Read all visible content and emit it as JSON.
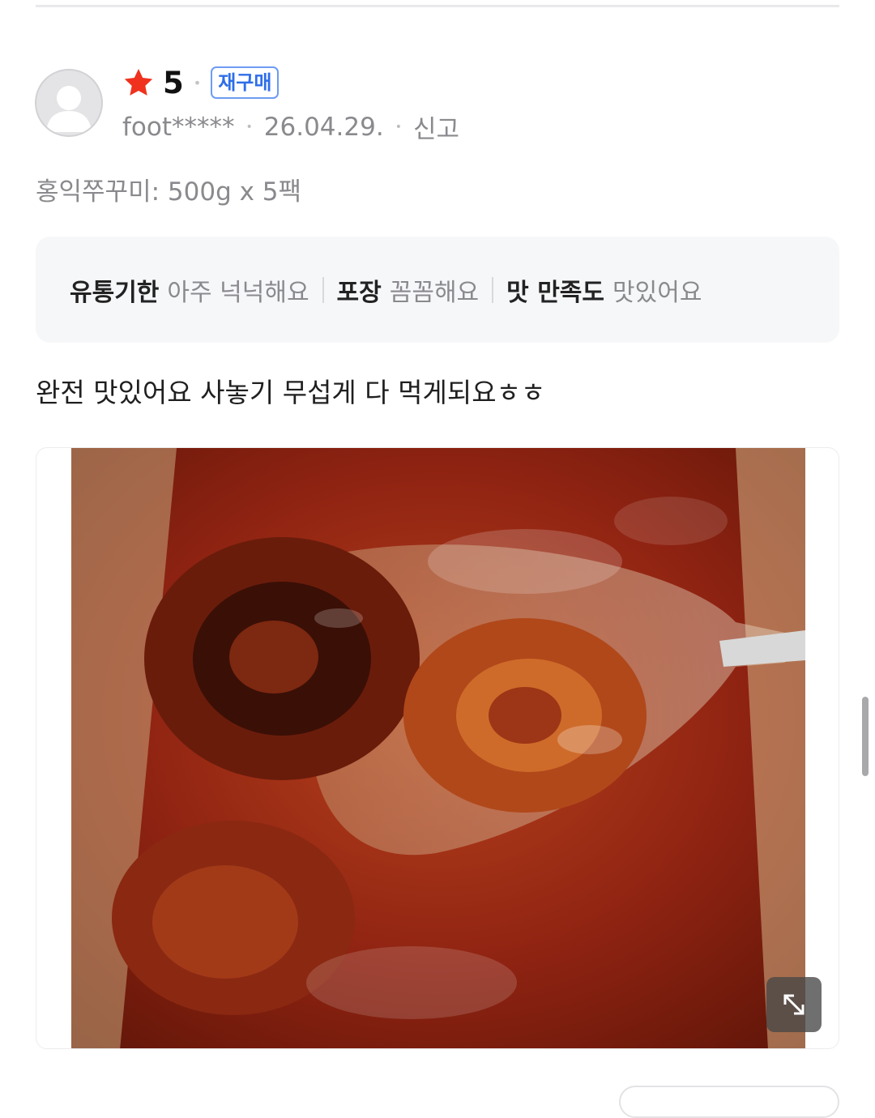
{
  "review": {
    "rating": "5",
    "badge": "재구매",
    "username": "foot*****",
    "date": "26.04.29.",
    "report_label": "신고",
    "option_text": "홍익쭈꾸미: 500g x 5팩",
    "evaluations": [
      {
        "key": "유통기한",
        "value": "아주 넉넉해요"
      },
      {
        "key": "포장",
        "value": "꼼꼼해요"
      },
      {
        "key": "맛 만족도",
        "value": "맛있어요"
      }
    ],
    "text": "완전 맛있어요 사놓기 무섭게 다 먹게되요ㅎㅎ"
  },
  "icons": {
    "star": "star-icon",
    "avatar": "default-user-avatar",
    "expand": "expand-diagonal-icon"
  },
  "colors": {
    "star": "#f0311e",
    "badge": "#2e6ee9",
    "eval_bg": "#f6f7f9"
  }
}
